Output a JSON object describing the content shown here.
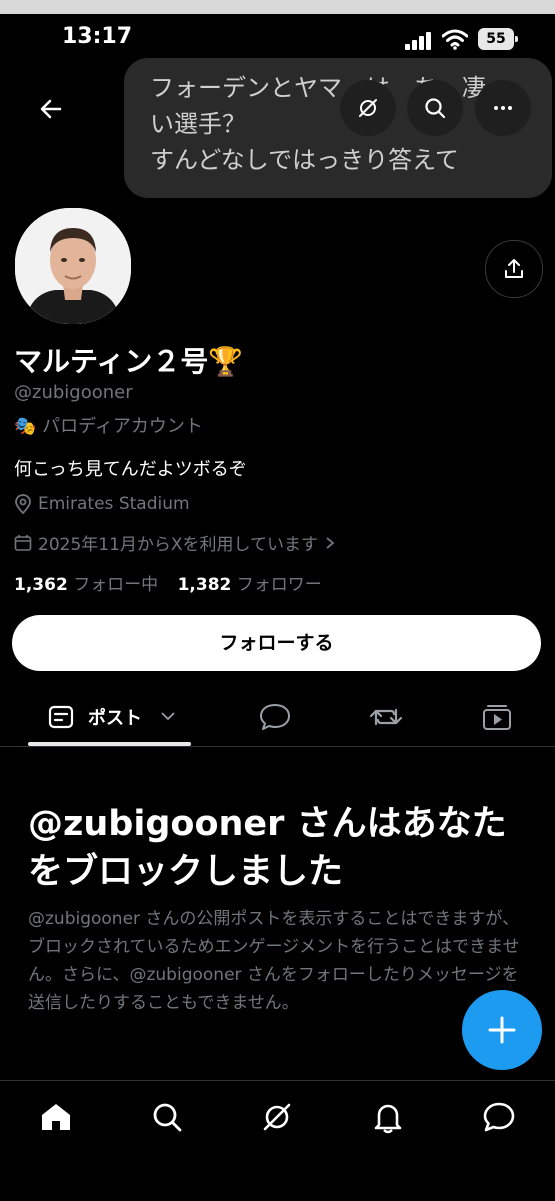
{
  "status_bar": {
    "time": "13:17",
    "battery": "55"
  },
  "overlay": {
    "text_line1": "フォーデンとヤマ　は　ち　凄",
    "text_line2": "い選手？",
    "text_line3": "すんどなしではっきり答えて"
  },
  "profile": {
    "name": "マルティン２号🏆",
    "handle": "@zubigooner",
    "parody_icon": "🎭",
    "parody_label": "パロディアカウント",
    "bio": "何こっち見てんだよツボるぞ",
    "location": "Emirates Stadium",
    "joined": "2025年11月からXを利用しています",
    "following_count": "1,362",
    "following_label": "フォロー中",
    "followers_count": "1,382",
    "followers_label": "フォロワー",
    "follow_button": "フォローする"
  },
  "tabs": {
    "posts_label": "ポスト"
  },
  "blocked": {
    "title": "@zubigooner さんはあなたをブロックしました",
    "description": "@zubigooner さんの公開ポストを表示することはできますが、ブロックされているためエンゲージメントを行うことはできません。さらに、@zubigooner さんをフォローしたりメッセージを送信したりすることもできません。"
  },
  "icons": {
    "back": "arrow-left-icon",
    "grok": "grok-icon",
    "search": "search-icon",
    "more": "more-icon",
    "share": "share-icon",
    "location": "location-pin-icon",
    "calendar": "calendar-icon",
    "compose": "plus-icon"
  },
  "colors": {
    "accent": "#1d9bf0",
    "muted": "#71767b",
    "background": "#000000"
  }
}
